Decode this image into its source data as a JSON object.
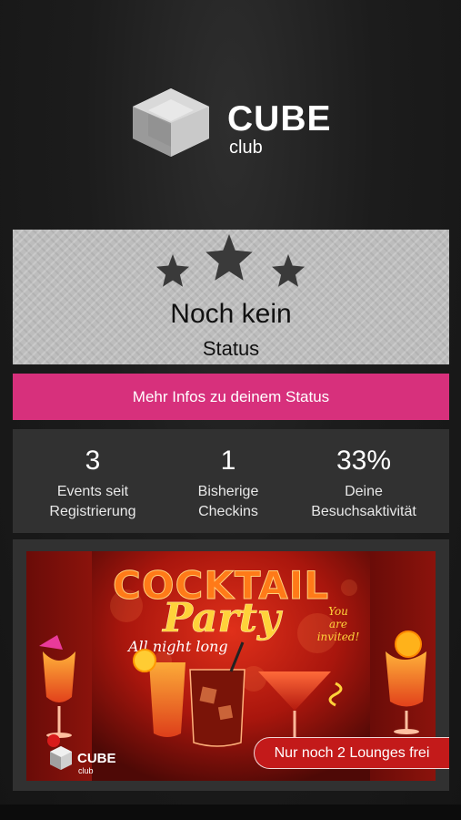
{
  "brand": {
    "name": "CUBE",
    "sub": "club"
  },
  "status": {
    "title": "Noch kein",
    "subtitle": "Status",
    "info_button": "Mehr Infos zu deinem Status"
  },
  "stats": [
    {
      "value": "3",
      "label_line1": "Events seit",
      "label_line2": "Registrierung"
    },
    {
      "value": "1",
      "label_line1": "Bisherige",
      "label_line2": "Checkins"
    },
    {
      "value": "33%",
      "label_line1": "Deine",
      "label_line2": "Besuchsaktivität"
    }
  ],
  "promo": {
    "headline": "COCKTAIL",
    "script": "Party",
    "tagline": "All night long",
    "invite_line1": "You",
    "invite_line2": "are",
    "invite_line3": "invited!",
    "logo_name": "CUBE",
    "logo_sub": "club",
    "cta": "Nur noch 2 Lounges frei"
  },
  "colors": {
    "accent": "#d7307c",
    "cta": "#c31a1a",
    "panel": "#313131"
  }
}
